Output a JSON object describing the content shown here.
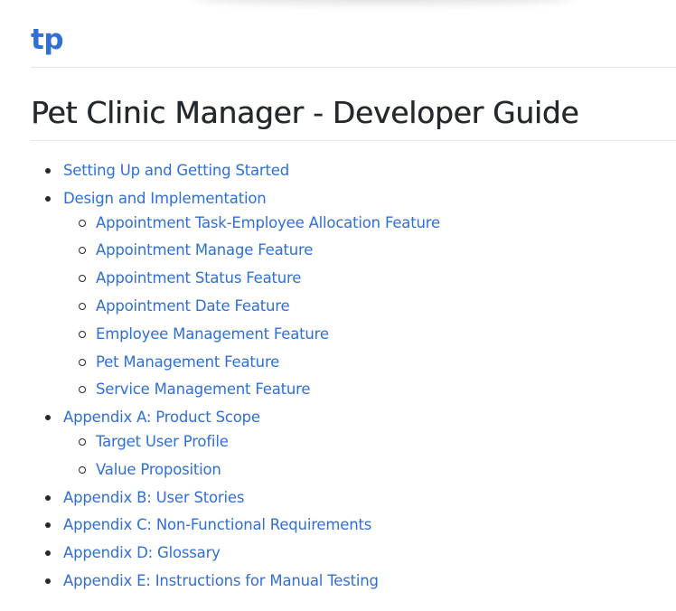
{
  "site": {
    "title": "tp"
  },
  "doc": {
    "title": "Pet Clinic Manager - Developer Guide"
  },
  "toc": [
    {
      "label": "Setting Up and Getting Started",
      "children": []
    },
    {
      "label": "Design and Implementation",
      "children": [
        "Appointment Task-Employee Allocation Feature",
        "Appointment Manage Feature",
        "Appointment Status Feature",
        "Appointment Date Feature",
        "Employee Management Feature",
        "Pet Management Feature",
        "Service Management Feature"
      ]
    },
    {
      "label": "Appendix A: Product Scope",
      "children": [
        "Target User Profile",
        "Value Proposition"
      ]
    },
    {
      "label": "Appendix B: User Stories",
      "children": []
    },
    {
      "label": "Appendix C: Non-Functional Requirements",
      "children": []
    },
    {
      "label": "Appendix D: Glossary",
      "children": []
    },
    {
      "label": "Appendix E: Instructions for Manual Testing",
      "children": []
    }
  ],
  "colors": {
    "link": "#2f6fd6",
    "text": "#24292e",
    "rule": "#e4e6ea"
  }
}
